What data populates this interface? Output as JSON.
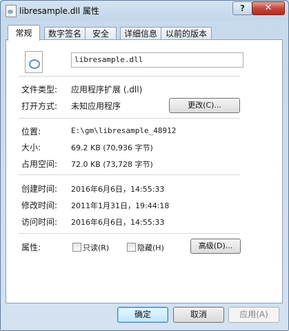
{
  "window": {
    "title": "libresample.dll 属性",
    "help_glyph": "?",
    "close_glyph": "✕"
  },
  "tabs": [
    {
      "label": "常规",
      "active": true
    },
    {
      "label": "数字签名",
      "active": false
    },
    {
      "label": "安全",
      "active": false
    },
    {
      "label": "详细信息",
      "active": false
    },
    {
      "label": "以前的版本",
      "active": false
    }
  ],
  "general": {
    "file_name": "libresample.dll",
    "file_type_label": "文件类型:",
    "file_type_value": "应用程序扩展 (.dll)",
    "open_with_label": "打开方式:",
    "open_with_value": "未知应用程序",
    "change_button": "更改(C)...",
    "location_label": "位置:",
    "location_value": "E:\\gm\\libresample_48912",
    "size_label": "大小:",
    "size_value": "69.2 KB (70,936 字节)",
    "size_on_disk_label": "占用空间:",
    "size_on_disk_value": "72.0 KB (73,728 字节)",
    "created_label": "创建时间:",
    "created_value": "2016年6月6日，14:55:33",
    "modified_label": "修改时间:",
    "modified_value": "2011年1月31日，19:44:18",
    "accessed_label": "访问时间:",
    "accessed_value": "2016年6月6日，14:55:33",
    "attributes_label": "属性:",
    "readonly_label": "只读(R)",
    "readonly_checked": false,
    "hidden_label": "隐藏(H)",
    "hidden_checked": false,
    "advanced_button": "高级(D)..."
  },
  "footer": {
    "ok": "确定",
    "cancel": "取消",
    "apply": "应用(A)"
  }
}
